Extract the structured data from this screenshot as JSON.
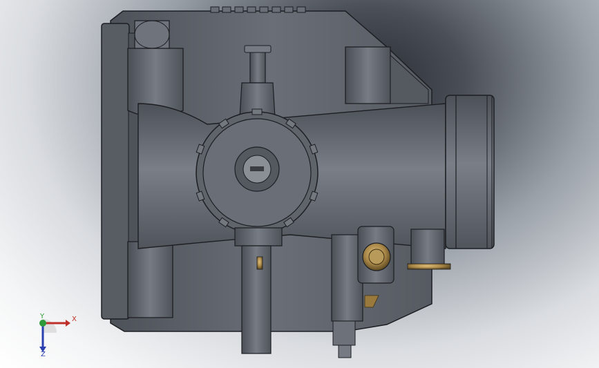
{
  "viewport": {
    "background_colors": [
      "#2a2d33",
      "#9aa0a8",
      "#ffffff"
    ],
    "model_color": "#5d6168",
    "brass_color": "#9a7a3c"
  },
  "triad": {
    "x_label": "X",
    "y_label": "Y",
    "z_label": "Z",
    "x_color": "#c0302a",
    "y_color": "#2f9a3a",
    "z_color": "#2a3fb0"
  }
}
